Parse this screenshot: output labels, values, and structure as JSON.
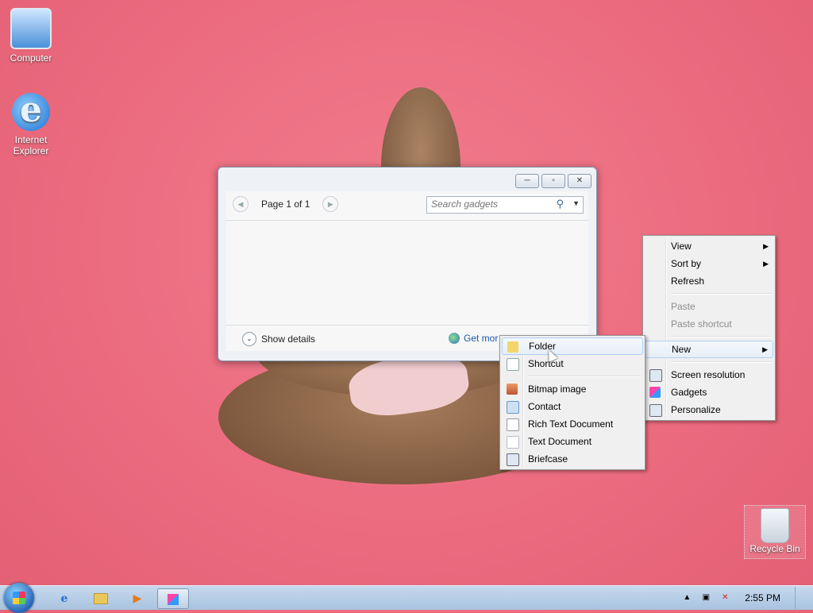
{
  "desktop": {
    "icons": [
      {
        "label": "Computer",
        "icon": "computer-icon"
      },
      {
        "label": "Internet Explorer",
        "icon": "internet-explorer-icon"
      },
      {
        "label": "Recycle Bin",
        "icon": "recycle-bin-icon"
      }
    ]
  },
  "gadgets_window": {
    "page_label": "Page 1 of 1",
    "search_placeholder": "Search gadgets",
    "show_details": "Show details",
    "get_more": "Get mor",
    "buttons": {
      "minimize": "─",
      "restore": "▫",
      "close": "✕"
    }
  },
  "desktop_menu": {
    "items": [
      {
        "label": "View",
        "submenu": true
      },
      {
        "label": "Sort by",
        "submenu": true
      },
      {
        "label": "Refresh"
      },
      {
        "label": "Paste",
        "disabled": true
      },
      {
        "label": "Paste shortcut",
        "disabled": true
      },
      {
        "label": "New",
        "submenu": true
      },
      {
        "label": "Screen resolution"
      },
      {
        "label": "Gadgets"
      },
      {
        "label": "Personalize"
      }
    ]
  },
  "new_submenu": {
    "items": [
      {
        "label": "Folder"
      },
      {
        "label": "Shortcut"
      },
      {
        "label": "Bitmap image"
      },
      {
        "label": "Contact"
      },
      {
        "label": "Rich Text Document"
      },
      {
        "label": "Text Document"
      },
      {
        "label": "Briefcase"
      }
    ]
  },
  "taskbar": {
    "time": "2:55 PM",
    "pinned": [
      "internet-explorer-icon",
      "windows-explorer-icon",
      "media-player-icon",
      "gadgets-icon"
    ]
  },
  "colors": {
    "accent": "#aecff7",
    "link": "#1e5bab",
    "wallpaper": "#ec6b7f"
  }
}
